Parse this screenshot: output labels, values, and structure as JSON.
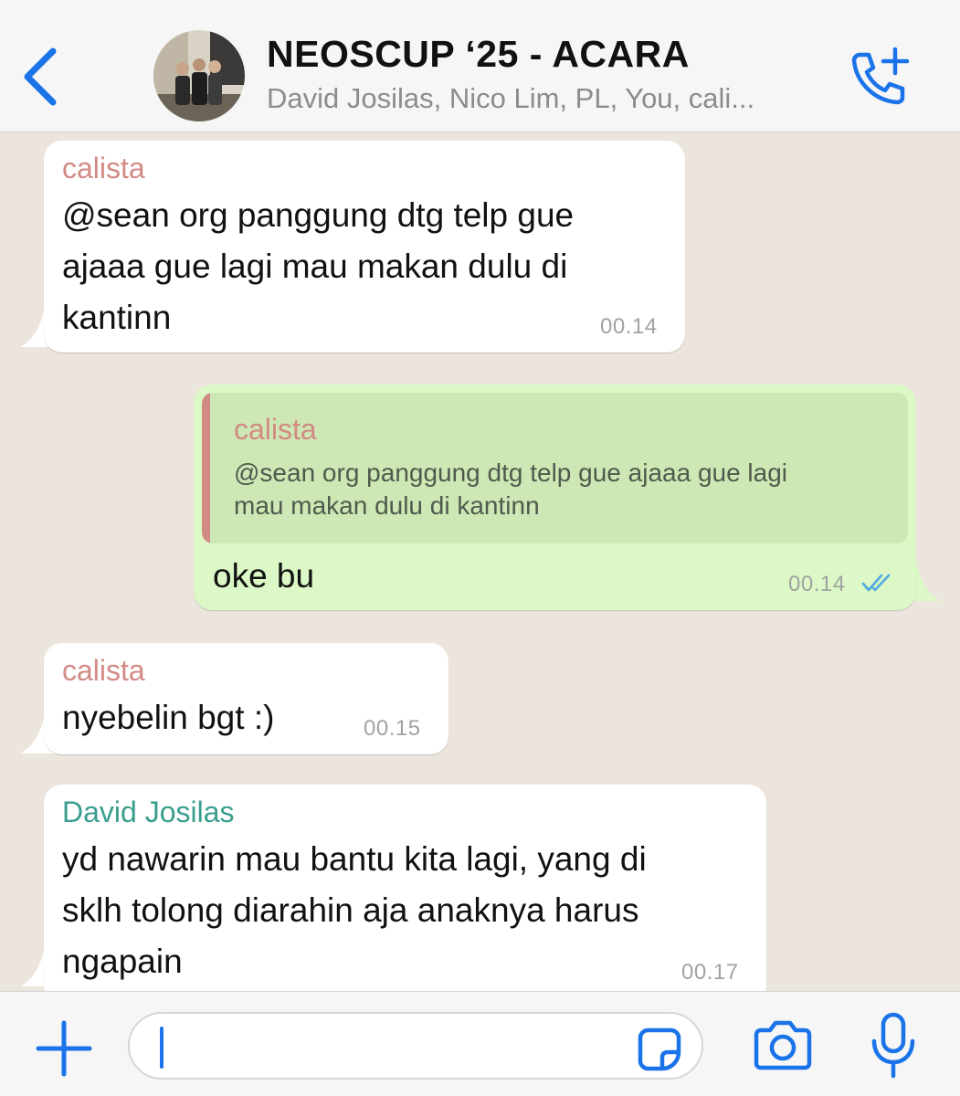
{
  "header": {
    "title": "NEOSCUP ‘25 - ACARA",
    "members": "David Josilas, Nico Lim, PL, You, cali..."
  },
  "messages": [
    {
      "sender": "calista",
      "text_lines": [
        "@sean org panggung dtg telp gue",
        "ajaaa gue lagi mau makan dulu di",
        "kantinn"
      ],
      "time": "00.14"
    },
    {
      "quote": {
        "sender": "calista",
        "text_lines": [
          "@sean org panggung dtg telp gue ajaaa gue lagi",
          "mau makan dulu di kantinn"
        ]
      },
      "text": "oke bu",
      "time": "00.14",
      "status": "read"
    },
    {
      "sender": "calista",
      "text": "nyebelin bgt :)",
      "time": "00.15"
    },
    {
      "sender": "David Josilas",
      "text_lines": [
        "yd nawarin mau bantu kita lagi, yang di",
        "sklh tolong diarahin aja anaknya harus",
        "ngapain"
      ],
      "time": "00.17"
    }
  ],
  "input": {
    "value": "",
    "icons": [
      "plus-icon",
      "sticker-icon",
      "camera-icon",
      "microphone-icon"
    ]
  },
  "colors": {
    "accent": "#1a73e8",
    "incoming_bubble": "#ffffff",
    "outgoing_bubble": "#dcf8c6",
    "chat_background": "#ece5dd",
    "sender_calista": "#d28a84",
    "sender_david": "#3a9e8f",
    "read_ticks": "#4fa8e0"
  }
}
